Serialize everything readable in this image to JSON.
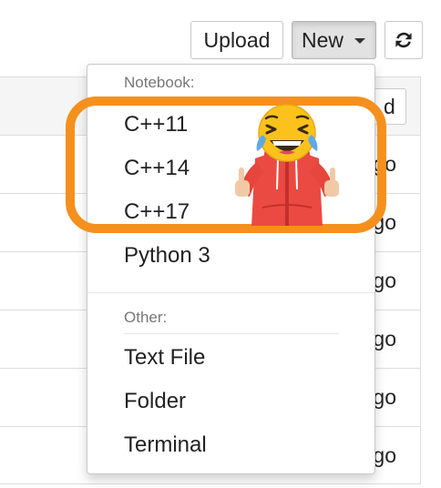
{
  "toolbar": {
    "upload_label": "Upload",
    "new_label": "New",
    "refresh_icon": "refresh-icon"
  },
  "file_list": {
    "header_button_text": "d",
    "row_times": [
      "go",
      "go",
      "go",
      "go",
      "go",
      "go"
    ]
  },
  "new_menu": {
    "notebook_header": "Notebook:",
    "notebook_items": [
      "C++11",
      "C++14",
      "C++17",
      "Python 3"
    ],
    "other_header": "Other:",
    "other_items": [
      "Text File",
      "Folder",
      "Terminal"
    ]
  },
  "annotation": {
    "highlight_color": "#f5901e",
    "sticker": "laughing-emoji-thumbs-up-person"
  }
}
